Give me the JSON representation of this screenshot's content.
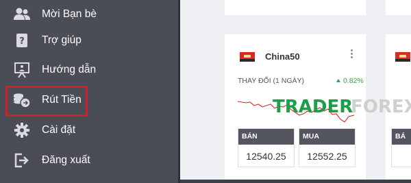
{
  "sidebar": {
    "items": [
      {
        "label": "Mời Bạn bè",
        "icon": "friends-icon"
      },
      {
        "label": "Trợ giúp",
        "icon": "help-icon"
      },
      {
        "label": "Hướng dẫn",
        "icon": "tutorial-icon"
      },
      {
        "label": "Rút Tiền",
        "icon": "withdraw-icon",
        "highlighted": true
      },
      {
        "label": "Cài đặt",
        "icon": "gear-icon"
      },
      {
        "label": "Đăng xuất",
        "icon": "logout-icon"
      }
    ],
    "highlight_color": "#d1202a"
  },
  "card": {
    "symbol": "China50",
    "flag_icon": "china-flag-icon",
    "change_label": "THAY ĐỔI (1 NGÀY)",
    "change_value": "0.82%",
    "change_color": "#39a33c",
    "sell": {
      "label": "BÁN",
      "price": "12540.25"
    },
    "buy": {
      "label": "MUA",
      "price": "12552.25"
    }
  },
  "next_card": {
    "flag_icon": "china-flag-icon",
    "sell_label": "BÁ"
  },
  "watermark": {
    "part1": "TRADER",
    "part2": "FOREX",
    "color1": "#1e9e4a",
    "color2": "#c8c8c8"
  }
}
